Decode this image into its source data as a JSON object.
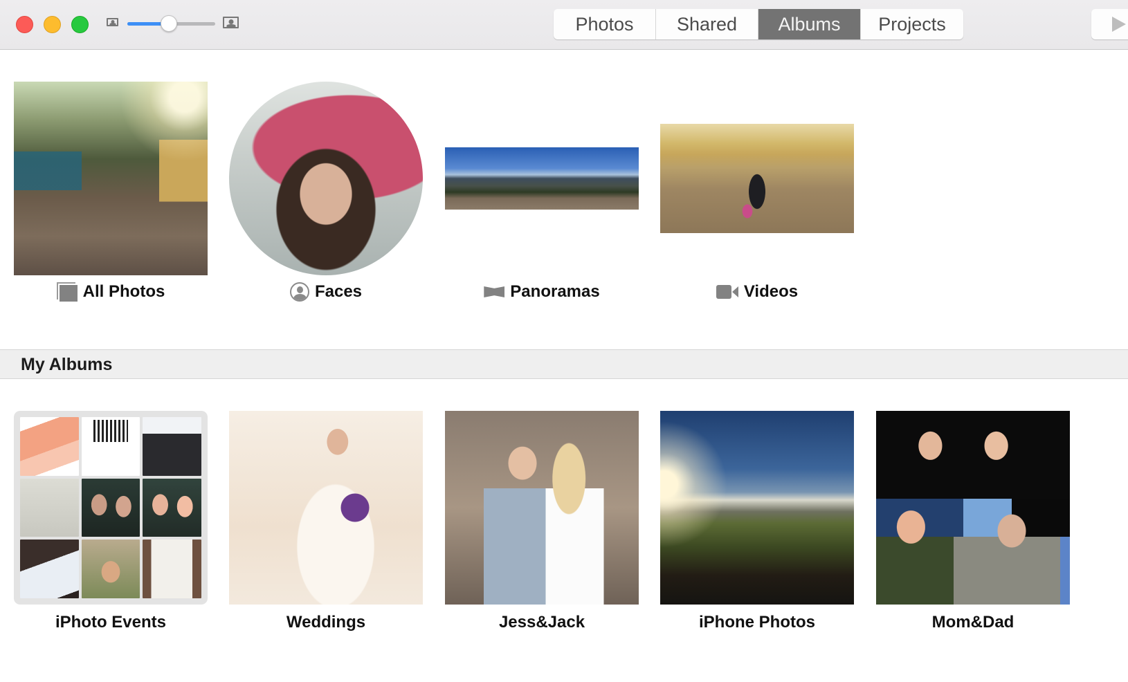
{
  "window": {
    "controls": [
      "close",
      "minimize",
      "zoom"
    ]
  },
  "toolbar": {
    "thumbnail_size_slider": {
      "value": 0.47,
      "min_icon": "small-photo-icon",
      "max_icon": "large-photo-icon"
    },
    "tabs": [
      {
        "label": "Photos",
        "active": false
      },
      {
        "label": "Shared",
        "active": false
      },
      {
        "label": "Albums",
        "active": true
      },
      {
        "label": "Projects",
        "active": false
      }
    ],
    "slideshow_icon": "play-icon"
  },
  "smart_albums": [
    {
      "label": "All Photos",
      "icon": "all-photos-icon"
    },
    {
      "label": "Faces",
      "icon": "faces-icon"
    },
    {
      "label": "Panoramas",
      "icon": "panorama-icon"
    },
    {
      "label": "Videos",
      "icon": "video-camera-icon"
    }
  ],
  "section": {
    "title": "My Albums"
  },
  "albums": [
    {
      "label": "iPhoto Events"
    },
    {
      "label": "Weddings"
    },
    {
      "label": "Jess&Jack"
    },
    {
      "label": "iPhone Photos"
    },
    {
      "label": "Mom&Dad"
    }
  ],
  "colors": {
    "slider_fill": "#3d8ff6",
    "active_tab": "#737373",
    "traffic_close": "#fc5b57",
    "traffic_minimize": "#fdbc2e",
    "traffic_zoom": "#27c93f"
  }
}
